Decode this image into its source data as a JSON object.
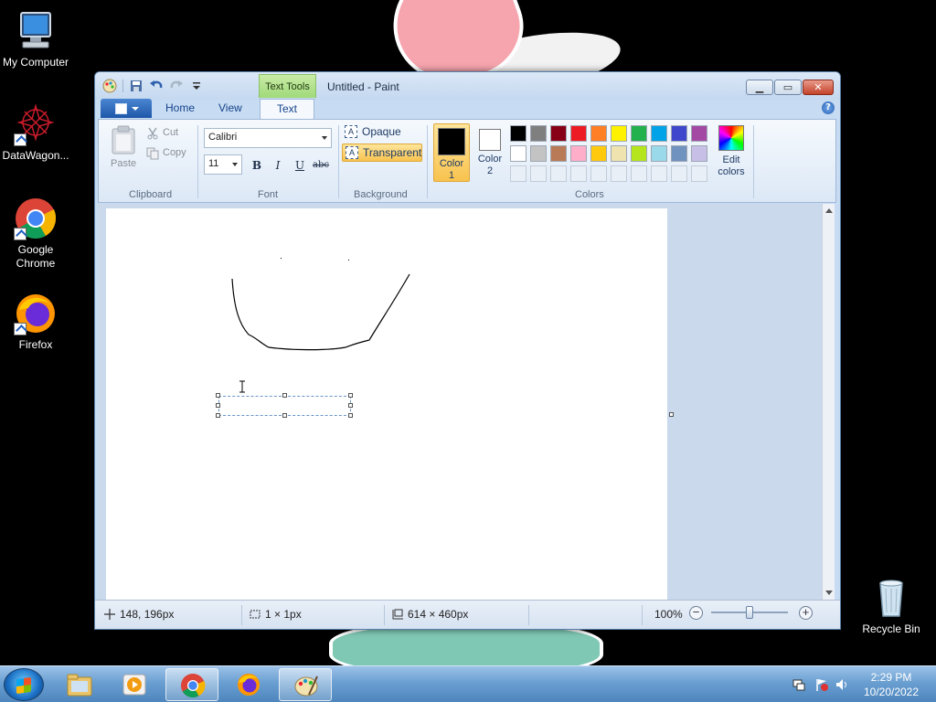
{
  "desktop": {
    "icons": [
      {
        "label": "My Computer"
      },
      {
        "label": "DataWagon..."
      },
      {
        "label": "Google Chrome"
      },
      {
        "label": "Firefox"
      },
      {
        "label": "Recycle Bin"
      }
    ]
  },
  "window": {
    "title": "Untitled - Paint",
    "context_tab": "Text Tools",
    "tabs": {
      "home": "Home",
      "view": "View",
      "text": "Text"
    },
    "help": "?"
  },
  "ribbon": {
    "clipboard": {
      "paste": "Paste",
      "cut": "Cut",
      "copy": "Copy",
      "label": "Clipboard"
    },
    "font": {
      "family": "Calibri",
      "size": "11",
      "bold": "B",
      "italic": "I",
      "underline": "U",
      "strike": "abc",
      "label": "Font"
    },
    "background": {
      "opaque": "Opaque",
      "transparent": "Transparent",
      "label": "Background"
    },
    "colors": {
      "color1_label": "Color\n1",
      "color2_label": "Color\n2",
      "color1": "#000000",
      "color2": "#ffffff",
      "palette": [
        "#000000",
        "#7f7f7f",
        "#880015",
        "#ed1c24",
        "#ff7f27",
        "#fff200",
        "#22b14c",
        "#00a2e8",
        "#3f48cc",
        "#a349a4",
        "#ffffff",
        "#c3c3c3",
        "#b97a57",
        "#ffaec9",
        "#ffc90e",
        "#efe4b0",
        "#b5e61d",
        "#99d9ea",
        "#7092be",
        "#c8bfe7"
      ],
      "edit_label": "Edit colors",
      "label": "Colors"
    }
  },
  "status": {
    "cursor_pos": "148, 196px",
    "selection_size": "1 × 1px",
    "canvas_size": "614 × 460px",
    "zoom": "100%",
    "zoom_level_fraction": 0.5
  },
  "taskbar": {
    "time": "2:29 PM",
    "date": "10/20/2022"
  }
}
